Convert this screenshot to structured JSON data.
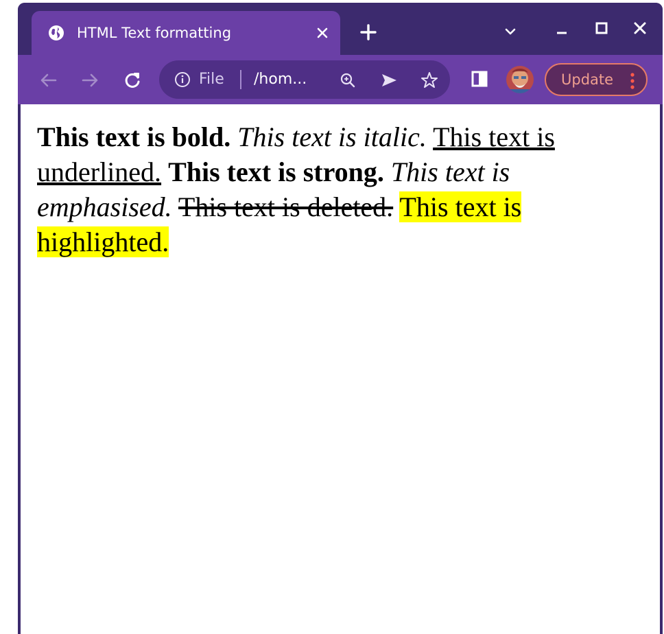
{
  "browser": {
    "tab": {
      "title": "HTML Text formatting",
      "favicon": "globe-icon",
      "close_icon": "close-icon"
    },
    "new_tab_icon": "plus-icon",
    "tab_search_icon": "chevron-down-icon",
    "window_controls": [
      "minimize-icon",
      "maximize-icon",
      "close-icon"
    ],
    "toolbar": {
      "back_icon": "arrow-left-icon",
      "forward_icon": "arrow-right-icon",
      "reload_icon": "reload-icon",
      "omnibox": {
        "scheme_label": "File",
        "url_display": "/hom...",
        "icons": [
          "info-icon",
          "zoom-icon",
          "send-icon",
          "star-icon"
        ]
      },
      "side_panel_icon": "side-panel-icon",
      "update_label": "Update",
      "menu_icon": "kebab-menu-icon"
    },
    "colors": {
      "frame": "#3c2a6e",
      "toolbar": "#6a3fa6",
      "omnibox": "#4f2f86",
      "update_border": "#e57a67",
      "update_text": "#f0a090",
      "highlight": "#ffff00"
    }
  },
  "page": {
    "bold": "This text is bold.",
    "italic": "This text is italic.",
    "underlined": "This text is underlined.",
    "strong": "This text is strong.",
    "emphasised": "This text is emphasised.",
    "deleted": "This text is deleted.",
    "highlighted": "This text is highlighted."
  }
}
